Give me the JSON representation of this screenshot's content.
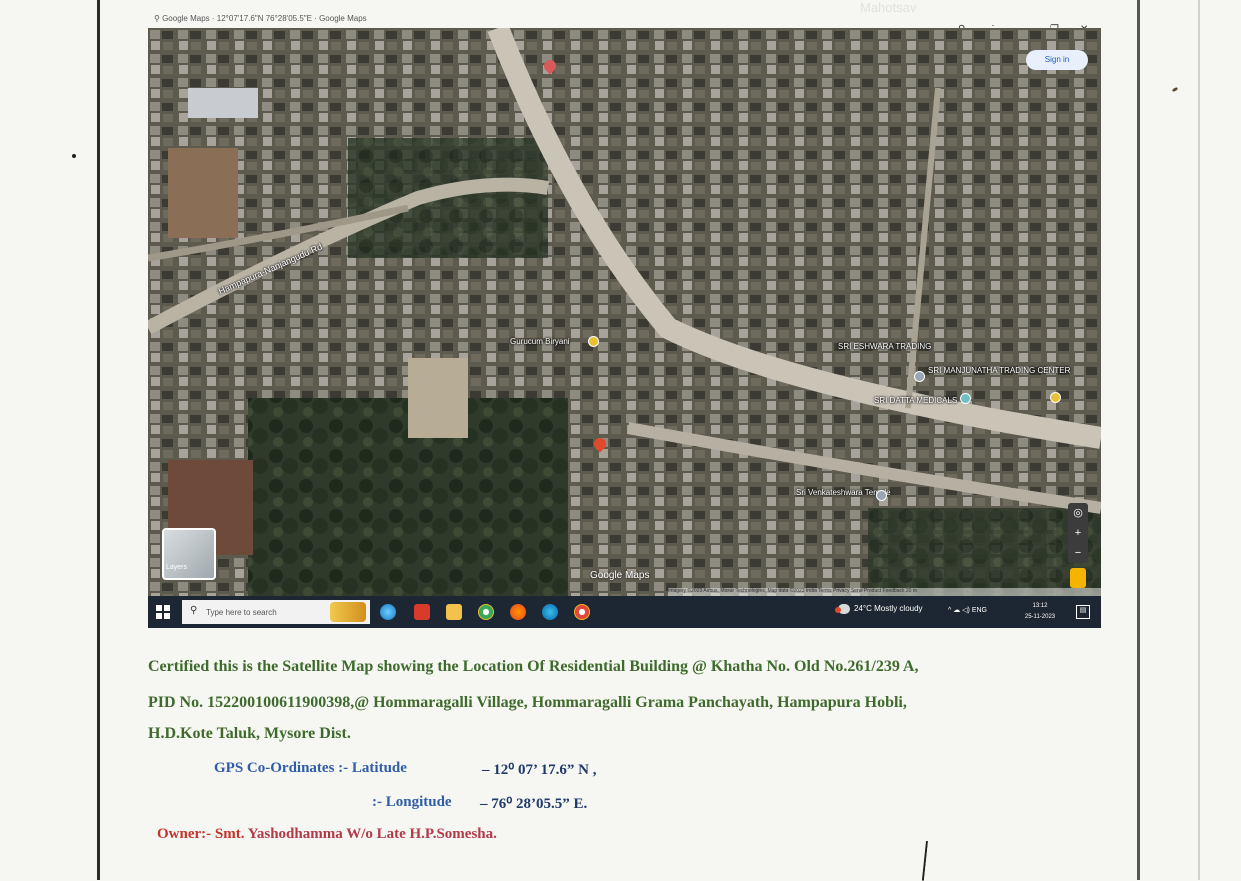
{
  "browser": {
    "tab_title": "⚲  Google Maps  ·  12°07'17.6\"N 76°28'05.5\"E  ·  Google Maps",
    "faint_watermark": "Mahotsav",
    "controls": {
      "location_icon": "⚲",
      "menu_icon": "⋮",
      "minimize": "–",
      "restore": "❐",
      "close": "✕"
    }
  },
  "map": {
    "sign_in_label": "Sign in",
    "road_label": "Hampapura-Nanjangudu Rd",
    "pois": [
      {
        "label": "Gurucum Biryani"
      },
      {
        "label": "SRI ESHWARA TRADING"
      },
      {
        "label": "SRI MANJUNATHA TRADING CENTER"
      },
      {
        "label": "SRI DATTA MEDICALS"
      },
      {
        "label": "Sri Venkateshwara Temple"
      }
    ],
    "layers_label": "Layers",
    "logo": "Google Maps",
    "attribution": "Imagery ©2023 Airbus, Maxar Technologies, Map data ©2023  India  Terms  Privacy  Send Product Feedback  20 m",
    "zoom_in": "+",
    "zoom_out": "−",
    "locate": "◎"
  },
  "taskbar": {
    "search_placeholder": "Type here to search",
    "search_icon": "⚲",
    "weather": "24°C  Mostly cloudy",
    "tray": "^  ☁  ◁)  ENG",
    "time": "13:12",
    "date": "25-11-2023",
    "apps": [
      "windows-icon",
      "edge-icon",
      "office-icon",
      "file-explorer-icon",
      "chrome-icon",
      "firefox-icon",
      "edge-browser-icon",
      "chrome-alt-icon"
    ]
  },
  "certificate": {
    "line1": "Certified this is the Satellite Map showing the Location Of  Residential Building @ Khatha  No. Old No.261/239 A,",
    "line2": "PID No. 152200100611900398,@ Hommaragalli Village, Hommaragalli  Grama Panchayath, Hampapura Hobli,",
    "line3": "H.D.Kote Taluk, Mysore Dist.",
    "gps_label": "GPS Co-Ordinates :- Latitude",
    "latitude": "– 12⁰ 07’ 17.6” N ,",
    "longitude_label": ":- Longitude",
    "longitude": "– 76⁰ 28’05.5” E.",
    "owner_label": "Owner:- Smt.",
    "owner_name": "Yashodhamma W/o Late H.P.Somesha."
  }
}
